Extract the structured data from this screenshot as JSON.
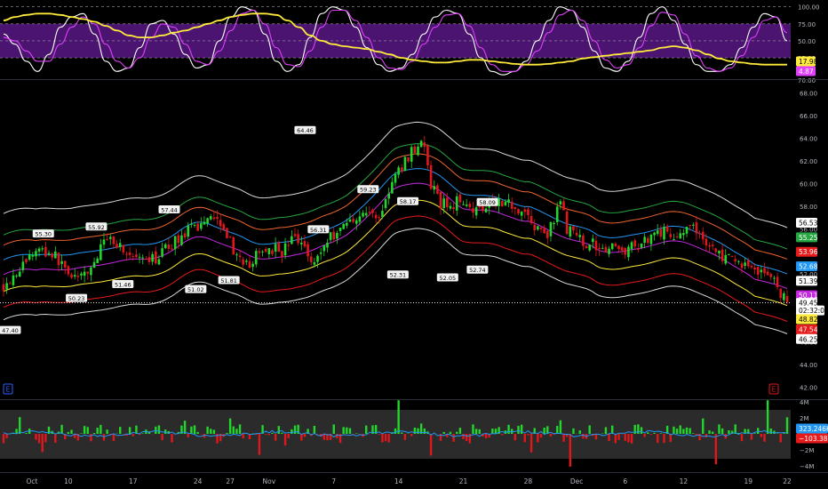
{
  "chart_data": {
    "type": "candlestick",
    "x_ticks": [
      {
        "label": "Oct",
        "t": 0
      },
      {
        "label": "10",
        "t": 20
      },
      {
        "label": "17",
        "t": 40
      },
      {
        "label": "24",
        "t": 60
      },
      {
        "label": "27",
        "t": 70
      },
      {
        "label": "Nov",
        "t": 82
      },
      {
        "label": "7",
        "t": 102
      },
      {
        "label": "14",
        "t": 122
      },
      {
        "label": "21",
        "t": 142
      },
      {
        "label": "28",
        "t": 162
      },
      {
        "label": "Dec",
        "t": 177
      },
      {
        "label": "6",
        "t": 192
      },
      {
        "label": "12",
        "t": 210
      },
      {
        "label": "19",
        "t": 230
      },
      {
        "label": "22",
        "t": 242
      }
    ],
    "price_panel": {
      "ylim": [
        41,
        69
      ],
      "y_ticks": [
        "42.00",
        "44.00",
        "46.00",
        "48.00",
        "50.00",
        "52.00",
        "54.00",
        "56.00",
        "58.00",
        "60.00",
        "62.00",
        "64.00",
        "66.00",
        "68.00"
      ],
      "close_points": [
        [
          0,
          51.0
        ],
        [
          6,
          52.8
        ],
        [
          10,
          54.2
        ],
        [
          15,
          53.8
        ],
        [
          20,
          52.2
        ],
        [
          24,
          51.5
        ],
        [
          28,
          53.0
        ],
        [
          32,
          55.4
        ],
        [
          36,
          54.5
        ],
        [
          40,
          53.3
        ],
        [
          44,
          52.9
        ],
        [
          48,
          53.6
        ],
        [
          52,
          54.7
        ],
        [
          56,
          55.6
        ],
        [
          60,
          56.2
        ],
        [
          64,
          57.4
        ],
        [
          68,
          56.4
        ],
        [
          70,
          54.8
        ],
        [
          74,
          52.4
        ],
        [
          78,
          53.5
        ],
        [
          82,
          54.4
        ],
        [
          86,
          54.0
        ],
        [
          90,
          55.3
        ],
        [
          94,
          54.0
        ],
        [
          96,
          53.0
        ],
        [
          100,
          55.0
        ],
        [
          104,
          56.1
        ],
        [
          108,
          57.0
        ],
        [
          112,
          57.4
        ],
        [
          116,
          57.1
        ],
        [
          120,
          60.0
        ],
        [
          124,
          62.0
        ],
        [
          128,
          63.6
        ],
        [
          130,
          63.2
        ],
        [
          132,
          59.7
        ],
        [
          135,
          58.3
        ],
        [
          138,
          58.0
        ],
        [
          142,
          58.7
        ],
        [
          146,
          57.6
        ],
        [
          150,
          58.5
        ],
        [
          154,
          58.5
        ],
        [
          158,
          58.0
        ],
        [
          162,
          57.2
        ],
        [
          164,
          56.0
        ],
        [
          168,
          55.6
        ],
        [
          170,
          56.5
        ],
        [
          172,
          58.6
        ],
        [
          174,
          56.0
        ],
        [
          178,
          55.0
        ],
        [
          182,
          54.6
        ],
        [
          186,
          54.4
        ],
        [
          190,
          54.1
        ],
        [
          194,
          54.3
        ],
        [
          198,
          55.0
        ],
        [
          202,
          55.9
        ],
        [
          206,
          55.4
        ],
        [
          210,
          55.8
        ],
        [
          214,
          55.9
        ],
        [
          218,
          54.5
        ],
        [
          222,
          53.5
        ],
        [
          226,
          53.0
        ],
        [
          230,
          52.8
        ],
        [
          234,
          52.2
        ],
        [
          238,
          51.5
        ],
        [
          242,
          49.2
        ]
      ],
      "bands": [
        {
          "name": "top-outer",
          "color": "#d9d9d9",
          "offset": 4.8
        },
        {
          "name": "green",
          "color": "#26a641",
          "offset": 2.9
        },
        {
          "name": "orange",
          "color": "#f0642d",
          "offset": 2.0
        },
        {
          "name": "blue",
          "color": "#2196f3",
          "offset": 0.7
        },
        {
          "name": "purple",
          "color": "#c428e0",
          "offset": -0.6
        },
        {
          "name": "yellow",
          "color": "#ffe93b",
          "offset": -2.1
        },
        {
          "name": "red",
          "color": "#e61a1a",
          "offset": -3.5
        },
        {
          "name": "bottom-outer",
          "color": "#d9d9d9",
          "offset": -4.6
        }
      ],
      "pivot_labels": [
        {
          "t": 2,
          "v": 47.4,
          "text": "47.40",
          "dir": "down"
        },
        {
          "t": 12,
          "v": 55.3,
          "text": "55.30",
          "dir": "up"
        },
        {
          "t": 22,
          "v": 50.23,
          "text": "50.23",
          "dir": "down"
        },
        {
          "t": 28,
          "v": 55.92,
          "text": "55.92",
          "dir": "up"
        },
        {
          "t": 36,
          "v": 51.46,
          "text": "51.46",
          "dir": "down"
        },
        {
          "t": 50,
          "v": 57.44,
          "text": "57.44",
          "dir": "up"
        },
        {
          "t": 58,
          "v": 51.02,
          "text": "51.02",
          "dir": "down"
        },
        {
          "t": 68,
          "v": 51.81,
          "text": "51.81",
          "dir": "down"
        },
        {
          "t": 91,
          "v": 64.46,
          "text": "64.46",
          "dir": "up"
        },
        {
          "t": 95,
          "v": 56.31,
          "text": "56.31",
          "dir": "down"
        },
        {
          "t": 110,
          "v": 59.23,
          "text": "59.23",
          "dir": "up"
        },
        {
          "t": 119,
          "v": 52.31,
          "text": "52.31",
          "dir": "down"
        },
        {
          "t": 122,
          "v": 58.17,
          "text": "58.17",
          "dir": "up"
        },
        {
          "t": 134,
          "v": 52.05,
          "text": "52.05",
          "dir": "down"
        },
        {
          "t": 143,
          "v": 52.74,
          "text": "52.74",
          "dir": "down"
        },
        {
          "t": 146,
          "v": 58.09,
          "text": "58.09",
          "dir": "up"
        }
      ],
      "last_price_line": 49.45,
      "right_labels": [
        {
          "text": "56.53",
          "v": 56.53,
          "bg": "#ffffff",
          "fg": "#000000"
        },
        {
          "text": "55.25",
          "v": 55.25,
          "bg": "#26a641",
          "fg": "#ffffff"
        },
        {
          "text": "53.96",
          "v": 53.96,
          "bg": "#e61a1a",
          "fg": "#ffffff"
        },
        {
          "text": "52.68",
          "v": 52.68,
          "bg": "#2196f3",
          "fg": "#ffffff"
        },
        {
          "text": "51.39",
          "v": 51.39,
          "bg": "#ffffff",
          "fg": "#000000"
        },
        {
          "text": "50.11",
          "v": 50.11,
          "bg": "#c428e0",
          "fg": "#ffffff"
        },
        {
          "text": "49.45",
          "v": 49.45,
          "bg": "#ffffff",
          "fg": "#000000"
        },
        {
          "text": "02:32:00",
          "v": 48.78,
          "bg": "#ffffff",
          "fg": "#000000"
        },
        {
          "text": "48.82",
          "v": 48.0,
          "bg": "#ffe93b",
          "fg": "#000000"
        },
        {
          "text": "47.54",
          "v": 47.1,
          "bg": "#e61a1a",
          "fg": "#ffffff"
        },
        {
          "text": "46.25",
          "v": 46.25,
          "bg": "#ffffff",
          "fg": "#000000"
        }
      ],
      "colors": {
        "up": "#22d62b",
        "down": "#e3161c"
      }
    },
    "oscillator_panel": {
      "ylim": [
        -5,
        110
      ],
      "band": [
        25,
        75
      ],
      "y_ticks": [
        {
          "label": "100.00",
          "v": 100
        },
        {
          "label": "75.00",
          "v": 75
        },
        {
          "label": "50.00",
          "v": 50
        },
        {
          "label": "25.00",
          "v": 25
        }
      ],
      "axis_text": "70.00",
      "series": [
        {
          "name": "k",
          "color": "#ffffff",
          "values": [
            60,
            45,
            20,
            5,
            30,
            70,
            85,
            90,
            60,
            20,
            5,
            10,
            40,
            75,
            80,
            60,
            30,
            10,
            15,
            50,
            85,
            100,
            95,
            60,
            20,
            5,
            15,
            55,
            90,
            100,
            95,
            70,
            40,
            15,
            5,
            10,
            30,
            60,
            85,
            95,
            90,
            60,
            25,
            5,
            0,
            5,
            20,
            50,
            80,
            100,
            95,
            70,
            35,
            10,
            5,
            20,
            55,
            90,
            100,
            80,
            45,
            15,
            5,
            5,
            15,
            40,
            70,
            90,
            85,
            50
          ]
        },
        {
          "name": "d",
          "color": "#e040fb",
          "values": [
            55,
            50,
            35,
            20,
            20,
            45,
            70,
            85,
            75,
            45,
            20,
            10,
            25,
            55,
            75,
            70,
            45,
            20,
            15,
            35,
            65,
            90,
            95,
            75,
            40,
            15,
            12,
            35,
            70,
            95,
            95,
            80,
            55,
            25,
            10,
            8,
            20,
            45,
            70,
            88,
            90,
            72,
            40,
            15,
            5,
            5,
            15,
            35,
            62,
            88,
            95,
            80,
            50,
            22,
            10,
            15,
            40,
            72,
            92,
            88,
            60,
            28,
            10,
            5,
            10,
            28,
            55,
            80,
            85,
            62
          ]
        },
        {
          "name": "signal",
          "color": "#ffeb3b",
          "values": [
            80,
            85,
            88,
            90,
            90,
            88,
            85,
            82,
            78,
            72,
            65,
            58,
            55,
            55,
            58,
            62,
            65,
            70,
            75,
            80,
            85,
            88,
            90,
            90,
            88,
            80,
            70,
            58,
            50,
            45,
            42,
            40,
            38,
            34,
            30,
            25,
            22,
            20,
            18,
            18,
            20,
            22,
            22,
            20,
            18,
            16,
            15,
            15,
            16,
            18,
            20,
            24,
            26,
            28,
            30,
            32,
            34,
            36,
            40,
            42,
            40,
            36,
            30,
            24,
            20,
            18,
            16,
            15,
            15,
            15
          ]
        }
      ],
      "readouts": [
        {
          "text": "17.98",
          "bg": "#ffeb3b",
          "fg": "#000000"
        },
        {
          "text": "4.87",
          "bg": "#e040fb",
          "fg": "#ffffff"
        }
      ]
    },
    "volume_panel": {
      "y_ticks": [
        "4M",
        "2M",
        "−2M",
        "−4M"
      ],
      "readouts": [
        {
          "text": "323.246K",
          "bg": "#2196f3",
          "fg": "#ffffff"
        },
        {
          "text": "−103.38K",
          "bg": "#e61a1a",
          "fg": "#ffffff"
        }
      ],
      "colors": {
        "pos": "#22d62b",
        "neg": "#e3161c",
        "line": "#2196f3"
      }
    },
    "markers": [
      {
        "text": "E",
        "panel": "price",
        "side": "left",
        "color": "#2962ff"
      },
      {
        "text": "E",
        "panel": "price",
        "side": "right",
        "color": "#e3161c"
      }
    ]
  }
}
